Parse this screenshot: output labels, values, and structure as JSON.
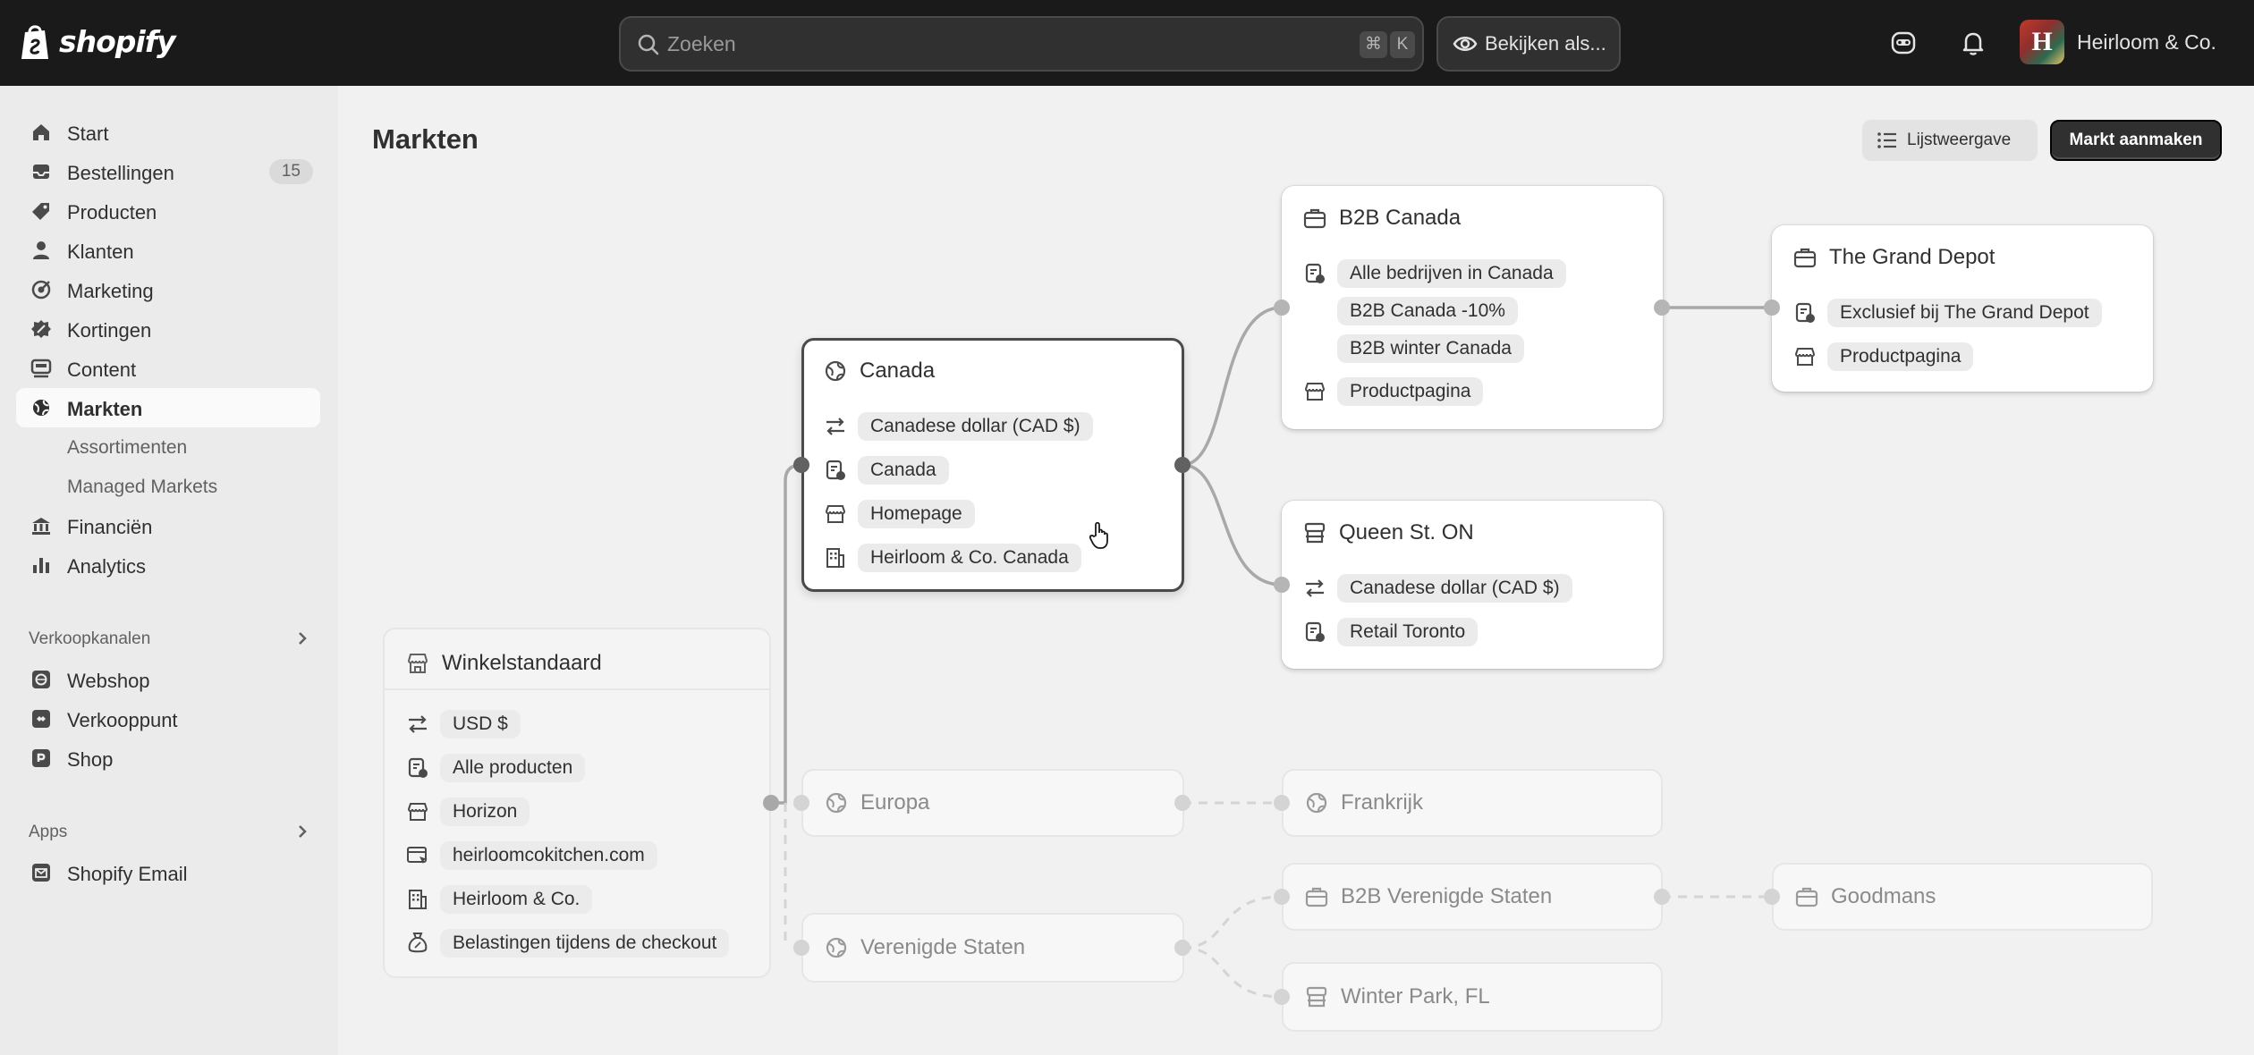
{
  "topbar": {
    "logo_text": "shopify",
    "search_placeholder": "Zoeken",
    "shortcut_key1": "⌘",
    "shortcut_key2": "K",
    "view_as_label": "Bekijken als...",
    "store_name": "Heirloom & Co.",
    "avatar_letter": "H"
  },
  "sidebar": {
    "items": [
      {
        "label": "Start",
        "icon": "home-icon"
      },
      {
        "label": "Bestellingen",
        "icon": "orders-icon",
        "badge": "15"
      },
      {
        "label": "Producten",
        "icon": "tag-icon"
      },
      {
        "label": "Klanten",
        "icon": "person-icon"
      },
      {
        "label": "Marketing",
        "icon": "target-icon"
      },
      {
        "label": "Kortingen",
        "icon": "discount-icon"
      },
      {
        "label": "Content",
        "icon": "content-icon"
      },
      {
        "label": "Markten",
        "icon": "globe-icon",
        "active": true
      },
      {
        "label": "Assortimenten",
        "sub": true
      },
      {
        "label": "Managed Markets",
        "sub": true
      },
      {
        "label": "Financiën",
        "icon": "bank-icon"
      },
      {
        "label": "Analytics",
        "icon": "chart-icon"
      }
    ],
    "sales_channels_header": "Verkoopkanalen",
    "sales_channels": [
      {
        "label": "Webshop",
        "icon": "webshop-icon"
      },
      {
        "label": "Verkooppunt",
        "icon": "pos-icon"
      },
      {
        "label": "Shop",
        "icon": "shop-icon"
      }
    ],
    "apps_header": "Apps",
    "apps": [
      {
        "label": "Shopify Email",
        "icon": "email-icon"
      }
    ]
  },
  "main": {
    "title": "Markten",
    "list_view_label": "Lijstweergave",
    "create_market_label": "Markt aanmaken"
  },
  "cards": {
    "winkelstandaard": {
      "title": "Winkelstandaard",
      "rows": [
        "USD $",
        "Alle producten",
        "Horizon",
        "heirloomcokitchen.com",
        "Heirloom & Co.",
        "Belastingen tijdens de checkout"
      ]
    },
    "canada": {
      "title": "Canada",
      "rows": [
        "Canadese dollar (CAD $)",
        "Canada",
        "Homepage",
        "Heirloom & Co. Canada"
      ]
    },
    "b2b_canada": {
      "title": "B2B Canada",
      "rows": [
        "Alle bedrijven in Canada",
        "B2B Canada -10%",
        "B2B winter Canada",
        "Productpagina"
      ]
    },
    "grand_depot": {
      "title": "The Grand Depot",
      "rows": [
        "Exclusief bij The Grand Depot",
        "Productpagina"
      ]
    },
    "queen_st": {
      "title": "Queen St. ON",
      "rows": [
        "Canadese dollar (CAD $)",
        "Retail Toronto"
      ]
    },
    "europa": {
      "title": "Europa"
    },
    "frankrijk": {
      "title": "Frankrijk"
    },
    "verenigde_staten": {
      "title": "Verenigde Staten"
    },
    "b2b_vs": {
      "title": "B2B Verenigde Staten"
    },
    "goodmans": {
      "title": "Goodmans"
    },
    "winter_park": {
      "title": "Winter Park, FL"
    }
  }
}
